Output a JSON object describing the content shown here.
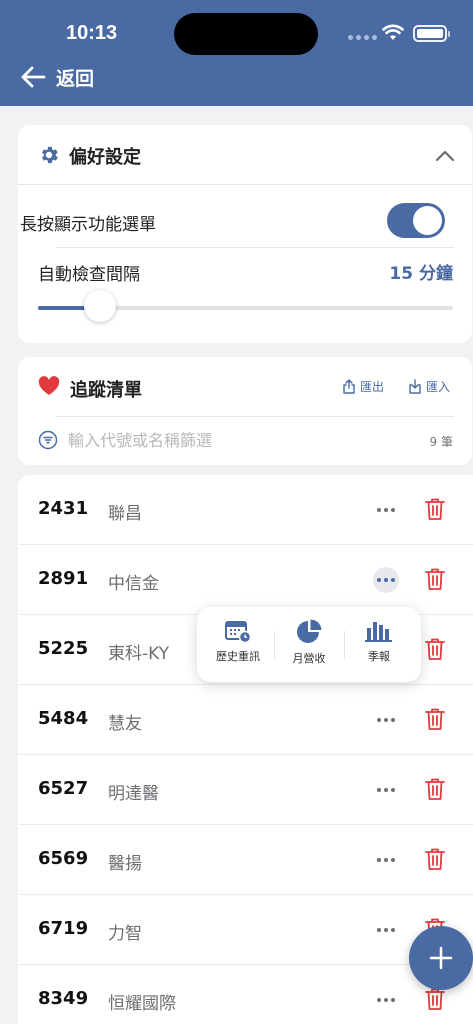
{
  "status_bar": {
    "time": "10:13"
  },
  "nav": {
    "back_label": "返回"
  },
  "preferences": {
    "title": "偏好設定",
    "long_press_label": "長按顯示功能選單",
    "long_press_enabled": true,
    "interval_label": "自動檢查間隔",
    "interval_value": "15 分鐘",
    "interval_slider_fraction": 0.15
  },
  "watchlist": {
    "title": "追蹤清單",
    "export_label": "匯出",
    "import_label": "匯入",
    "filter_placeholder": "輸入代號或名稱篩選",
    "count_label": "9 筆",
    "items": [
      {
        "code": "2431",
        "name": "聯昌"
      },
      {
        "code": "2891",
        "name": "中信金"
      },
      {
        "code": "5225",
        "name": "東科-KY"
      },
      {
        "code": "5484",
        "name": "慧友"
      },
      {
        "code": "6527",
        "name": "明達醫"
      },
      {
        "code": "6569",
        "name": "醫揚"
      },
      {
        "code": "6719",
        "name": "力智"
      },
      {
        "code": "8349",
        "name": "恒耀國際"
      }
    ]
  },
  "context_menu": {
    "items": [
      {
        "label": "歷史重訊",
        "icon": "calendar-clock-icon"
      },
      {
        "label": "月營收",
        "icon": "pie-chart-icon"
      },
      {
        "label": "季報",
        "icon": "bar-chart-icon"
      }
    ]
  },
  "colors": {
    "primary": "#4a6aa4",
    "danger": "#e0393e",
    "background": "#f2f2f4"
  }
}
